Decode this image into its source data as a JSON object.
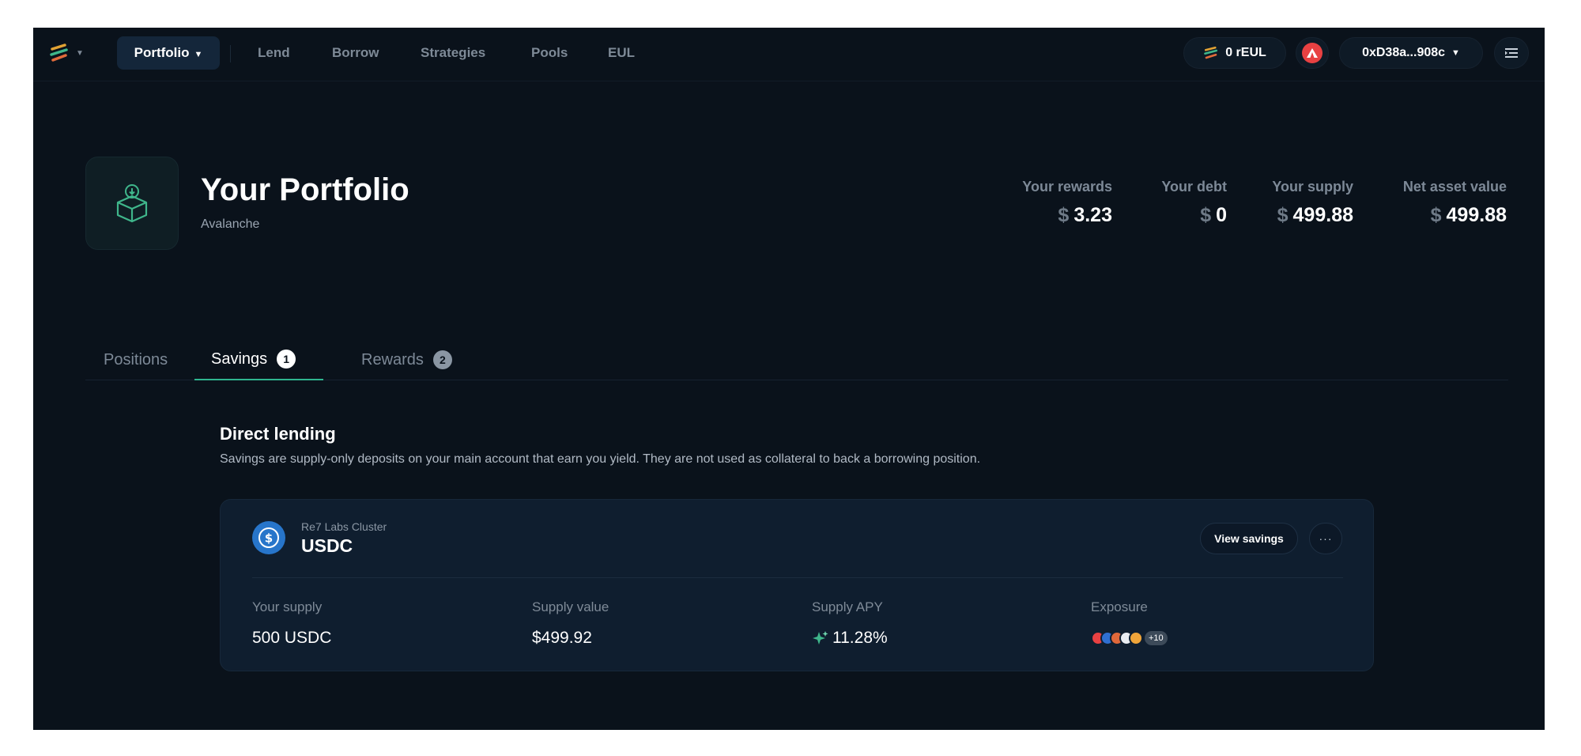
{
  "nav": {
    "items": [
      "Portfolio",
      "Lend",
      "Borrow",
      "Strategies",
      "Pools",
      "EUL"
    ],
    "rewards_pill": "0 rEUL",
    "chain_icon": "avalanche-icon",
    "wallet": "0xD38a...908c"
  },
  "header": {
    "title": "Your Portfolio",
    "subtitle": "Avalanche",
    "stats": [
      {
        "label": "Your rewards",
        "currency": "$",
        "value": "3.23"
      },
      {
        "label": "Your debt",
        "currency": "$",
        "value": "0"
      },
      {
        "label": "Your supply",
        "currency": "$",
        "value": "499.88"
      },
      {
        "label": "Net asset value",
        "currency": "$",
        "value": "499.88"
      }
    ]
  },
  "tabs": [
    {
      "label": "Positions",
      "badge": null
    },
    {
      "label": "Savings",
      "badge": "1"
    },
    {
      "label": "Rewards",
      "badge": "2"
    }
  ],
  "section": {
    "title": "Direct lending",
    "description": "Savings are supply-only deposits on your main account that earn you yield. They are not used as collateral to back a borrowing position."
  },
  "card": {
    "cluster": "Re7 Labs Cluster",
    "asset": "USDC",
    "asset_icon": "usdc-icon",
    "view_button": "View savings",
    "more_button": "···",
    "metrics": {
      "supply_label": "Your supply",
      "supply_value": "500 USDC",
      "value_label": "Supply value",
      "value_value": "$499.92",
      "apy_label": "Supply APY",
      "apy_value": "11.28%",
      "exposure_label": "Exposure",
      "exposure_more": "+10"
    }
  },
  "colors": {
    "background": "#0a121b",
    "accent": "#2fb58f",
    "card": "#0f1e2f",
    "avalanche": "#e84142",
    "usdc": "#2775ca"
  }
}
